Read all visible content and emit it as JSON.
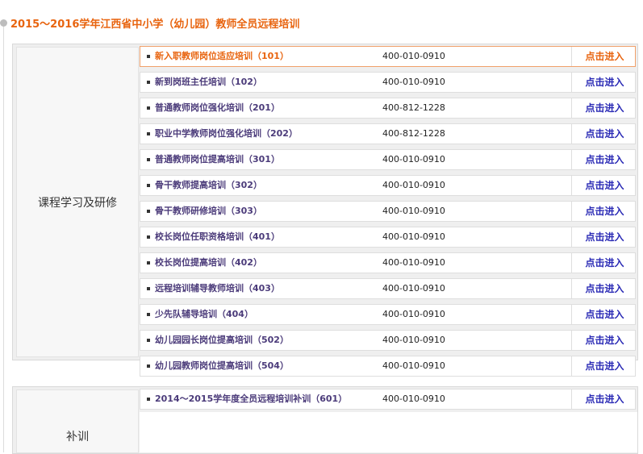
{
  "title": "2015～2016学年江西省中小学（幼儿园）教师全员远程培训",
  "sections": [
    {
      "category": "课程学习及研修",
      "rows": [
        {
          "name": "新入职教师岗位适应培训（101）",
          "phone": "400-010-0910",
          "action": "点击进入",
          "active": true
        },
        {
          "name": "新到岗班主任培训（102）",
          "phone": "400-010-0910",
          "action": "点击进入"
        },
        {
          "name": "普通教师岗位强化培训（201）",
          "phone": "400-812-1228",
          "action": "点击进入"
        },
        {
          "name": "职业中学教师岗位强化培训（202）",
          "phone": "400-812-1228",
          "action": "点击进入"
        },
        {
          "name": "普通教师岗位提高培训（301）",
          "phone": "400-010-0910",
          "action": "点击进入"
        },
        {
          "name": "骨干教师提高培训（302）",
          "phone": "400-010-0910",
          "action": "点击进入"
        },
        {
          "name": "骨干教师研修培训（303）",
          "phone": "400-010-0910",
          "action": "点击进入"
        },
        {
          "name": "校长岗位任职资格培训（401）",
          "phone": "400-010-0910",
          "action": "点击进入"
        },
        {
          "name": "校长岗位提高培训（402）",
          "phone": "400-010-0910",
          "action": "点击进入"
        },
        {
          "name": "远程培训辅导教师培训（403）",
          "phone": "400-010-0910",
          "action": "点击进入"
        },
        {
          "name": "少先队辅导培训（404）",
          "phone": "400-010-0910",
          "action": "点击进入"
        },
        {
          "name": "幼儿园园长岗位提高培训（502）",
          "phone": "400-010-0910",
          "action": "点击进入"
        },
        {
          "name": "幼儿园教师岗位提高培训（504）",
          "phone": "400-010-0910",
          "action": "点击进入"
        }
      ]
    },
    {
      "category": "补训",
      "rows": [
        {
          "name": "2014～2015学年度全员远程培训补训（601）",
          "phone": "400-010-0910",
          "action": "点击进入"
        }
      ]
    }
  ],
  "colors": {
    "accent": "#e8640f",
    "link": "#2a2ab5",
    "course_name": "#4b3b7a"
  }
}
